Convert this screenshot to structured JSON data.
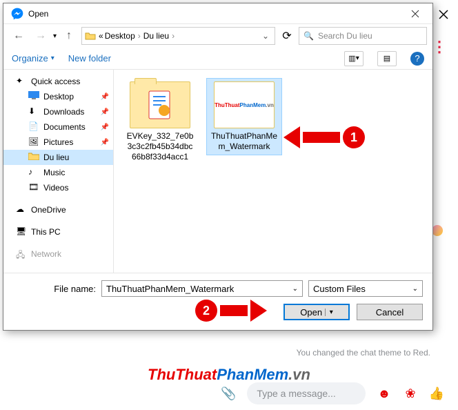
{
  "dialog": {
    "title": "Open",
    "breadcrumbs": {
      "pc_prefix": "«",
      "items": [
        "Desktop",
        "Du lieu"
      ],
      "drop": "›"
    },
    "nav": {
      "back": "←",
      "fwd": "→",
      "up": "↑",
      "refresh": "⟳"
    },
    "search": {
      "placeholder": "Search Du lieu",
      "icon": "🔍"
    },
    "toolbar": {
      "organize": "Organize",
      "newfolder": "New folder",
      "view_glyph": "▥",
      "layout_glyph": "▤",
      "help": "?"
    },
    "tree": {
      "quick": "Quick access",
      "desktop": "Desktop",
      "downloads": "Downloads",
      "documents": "Documents",
      "pictures": "Pictures",
      "dulieu": "Du lieu",
      "music": "Music",
      "videos": "Videos",
      "onedrive": "OneDrive",
      "thispc": "This PC",
      "network": "Network"
    },
    "files": {
      "item1": "EVKey_332_7e0b3c3c2fb45b34dbc66b8f33d4acc1",
      "item2": "ThuThuatPhanMem_Watermark",
      "wm_a": "ThuThuat",
      "wm_b": "PhanMem",
      "wm_c": ".vn"
    },
    "annot": {
      "one": "1",
      "two": "2"
    },
    "bottom": {
      "filename_label": "File name:",
      "filename_value": "ThuThuatPhanMem_Watermark",
      "filter": "Custom Files",
      "open": "Open",
      "cancel": "Cancel",
      "chev": "⌄"
    }
  },
  "bg": {
    "status": "You changed the chat theme to Red.",
    "wm_a": "ThuThuat",
    "wm_b": "PhanMem",
    "wm_c": ".vn",
    "input_placeholder": "Type a message...",
    "more": "⋮",
    "clip": "📎",
    "smile": "☻",
    "sticker": "❀",
    "like": "👍"
  }
}
